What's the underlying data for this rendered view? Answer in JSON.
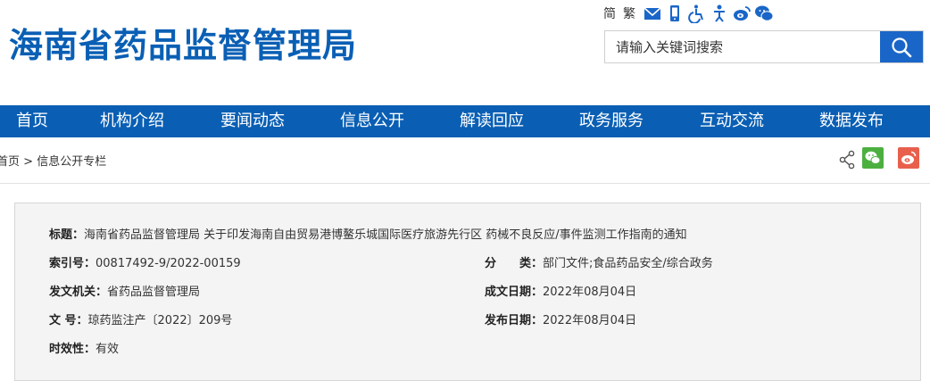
{
  "header": {
    "site_title": "海南省药品监督管理局",
    "lang_simplified": "简",
    "lang_traditional": "繁",
    "search_placeholder": "请输入关键词搜索"
  },
  "nav": {
    "items": [
      "首页",
      "机构介绍",
      "要闻动态",
      "信息公开",
      "解读回应",
      "政务服务",
      "互动交流",
      "数据发布"
    ]
  },
  "breadcrumb": {
    "home": "首页",
    "separator": ">",
    "current": "信息公开专栏"
  },
  "info": {
    "title_label": "标题：",
    "title_value": "海南省药品监督管理局 关于印发海南自由贸易港博鳌乐城国际医疗旅游先行区 药械不良反应/事件监测工作指南的通知",
    "index_label": "索引号：",
    "index_value": "00817492-9/2022-00159",
    "category_label": "分　　类：",
    "category_value": "部门文件;食品药品安全/综合政务",
    "issuer_label": "发文机关：",
    "issuer_value": "省药品监督管理局",
    "created_label": "成文日期：",
    "created_value": "2022年08月04日",
    "docno_label": "文 号：",
    "docno_value": "琼药监注产〔2022〕209号",
    "published_label": "发布日期：",
    "published_value": "2022年08月04日",
    "validity_label": "时效性：",
    "validity_value": "有效"
  },
  "colors": {
    "brand_blue": "#0a5fb4",
    "search_button": "#1a66c8",
    "wechat_green": "#4cb040",
    "weibo_red": "#e8604c"
  }
}
